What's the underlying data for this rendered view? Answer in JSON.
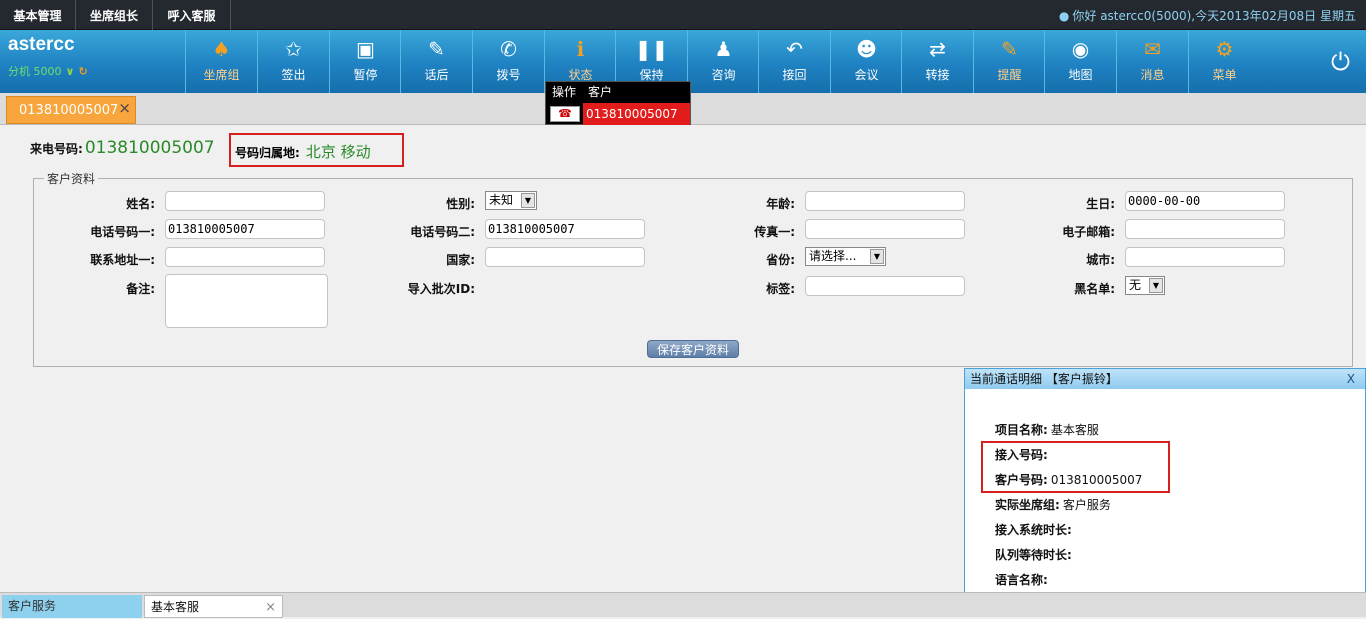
{
  "topnav": {
    "tabs": [
      "基本管理",
      "坐席组长",
      "呼入客服"
    ],
    "user_text": "你好 astercc0(5000),今天2013年02月08日 星期五"
  },
  "brand": {
    "name": "astercc",
    "extension": "分机 5000"
  },
  "toolbar": {
    "buttons": [
      {
        "label": "坐席组",
        "icon": "group-seat-icon"
      },
      {
        "label": "签出",
        "icon": "run-icon"
      },
      {
        "label": "暂停",
        "icon": "pause-square-icon"
      },
      {
        "label": "话后",
        "icon": "edit-icon"
      },
      {
        "label": "拨号",
        "icon": "phone-icon"
      },
      {
        "label": "状态",
        "icon": "info-icon"
      },
      {
        "label": "保持",
        "icon": "pause-icon"
      },
      {
        "label": "咨询",
        "icon": "users-icon"
      },
      {
        "label": "接回",
        "icon": "reply-icon"
      },
      {
        "label": "会议",
        "icon": "conference-icon"
      },
      {
        "label": "转接",
        "icon": "transfer-icon"
      },
      {
        "label": "提醒",
        "icon": "reminder-icon"
      },
      {
        "label": "地图",
        "icon": "globe-icon"
      },
      {
        "label": "消息",
        "icon": "mail-icon"
      },
      {
        "label": "菜单",
        "icon": "gear-icon"
      }
    ]
  },
  "popup": {
    "col_action": "操作",
    "col_customer": "客户",
    "customer_number": "013810005007"
  },
  "tabs": {
    "current": "013810005007"
  },
  "call": {
    "caller_label": "来电号码:",
    "caller_number": "013810005007",
    "location_label": "号码归属地:",
    "location_value": "北京 移动"
  },
  "form": {
    "legend": "客户资料",
    "name_label": "姓名:",
    "name_value": "",
    "gender_label": "性别:",
    "gender_value": "未知",
    "age_label": "年龄:",
    "age_value": "",
    "birthday_label": "生日:",
    "birthday_value": "0000-00-00",
    "phone1_label": "电话号码一:",
    "phone1_value": "013810005007",
    "phone2_label": "电话号码二:",
    "phone2_value": "013810005007",
    "fax_label": "传真一:",
    "fax_value": "",
    "email_label": "电子邮箱:",
    "email_value": "",
    "address_label": "联系地址一:",
    "address_value": "",
    "country_label": "国家:",
    "country_value": "",
    "province_label": "省份:",
    "province_value": "请选择...",
    "city_label": "城市:",
    "city_value": "",
    "note_label": "备注:",
    "note_value": "",
    "batch_label": "导入批次ID:",
    "tag_label": "标签:",
    "tag_value": "",
    "blacklist_label": "黑名单:",
    "blacklist_value": "无",
    "save_label": "保存客户资料"
  },
  "detail": {
    "title": "当前通话明细 【客户振铃】",
    "close": "X",
    "project_label": "项目名称:",
    "project_value": "基本客服",
    "access_label": "接入号码:",
    "access_value": "",
    "customer_label": "客户号码:",
    "customer_value": "013810005007",
    "queue_group_label": "实际坐席组:",
    "queue_group_value": "客户服务",
    "system_time_label": "接入系统时长:",
    "queue_wait_label": "队列等待时长:",
    "language_label": "语言名称:"
  },
  "bottom": {
    "tab1": "客户服务",
    "tab2": "基本客服"
  }
}
